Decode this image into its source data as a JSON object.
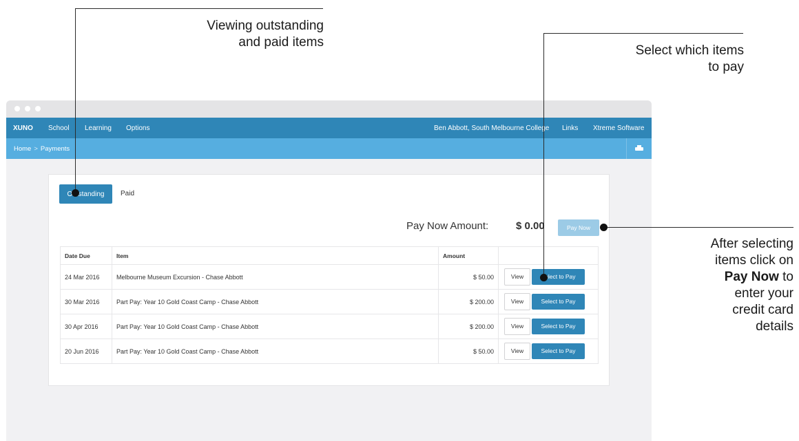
{
  "annotations": {
    "viewing": {
      "line1": "Viewing outstanding",
      "line2": "and paid items"
    },
    "select": {
      "line1": "Select which items",
      "line2": "to pay"
    },
    "after": {
      "line1": "After selecting",
      "line2": "items click on",
      "line3_bold": "Pay Now",
      "line3_rest": " to",
      "line4": "enter your",
      "line5": "credit card",
      "line6": "details"
    }
  },
  "nav": {
    "brand": "XUNO",
    "items": [
      "School",
      "Learning",
      "Options"
    ],
    "user": "Ben Abbott, South Melbourne College",
    "links": "Links",
    "company": "Xtreme Software"
  },
  "breadcrumb": {
    "home": "Home",
    "separator": ">",
    "current": "Payments"
  },
  "icons": {
    "print": "print-icon"
  },
  "tabs": {
    "outstanding": "Outstanding",
    "paid": "Paid"
  },
  "paynow": {
    "label": "Pay Now Amount:",
    "amount": "$ 0.00",
    "button": "Pay Now"
  },
  "table": {
    "headers": {
      "date": "Date Due",
      "item": "Item",
      "amount": "Amount",
      "actions": ""
    },
    "rows": [
      {
        "date": "24 Mar 2016",
        "item": "Melbourne Museum Excursion - Chase Abbott",
        "amount": "$ 50.00",
        "view": "View",
        "select": "Select to Pay"
      },
      {
        "date": "30 Mar 2016",
        "item": "Part Pay: Year 10 Gold Coast Camp - Chase Abbott",
        "amount": "$ 200.00",
        "view": "View",
        "select": "Select to Pay"
      },
      {
        "date": "30 Apr 2016",
        "item": "Part Pay: Year 10 Gold Coast Camp - Chase Abbott",
        "amount": "$ 200.00",
        "view": "View",
        "select": "Select to Pay"
      },
      {
        "date": "20 Jun 2016",
        "item": "Part Pay: Year 10 Gold Coast Camp - Chase Abbott",
        "amount": "$ 50.00",
        "view": "View",
        "select": "Select to Pay"
      }
    ]
  },
  "colors": {
    "navbar": "#2f86b7",
    "subbar": "#56aee0",
    "primary_button": "#2f86b7",
    "disabled_button": "#9ccbe6",
    "window_chrome": "#e4e4e6",
    "content_bg": "#f1f1f3"
  }
}
